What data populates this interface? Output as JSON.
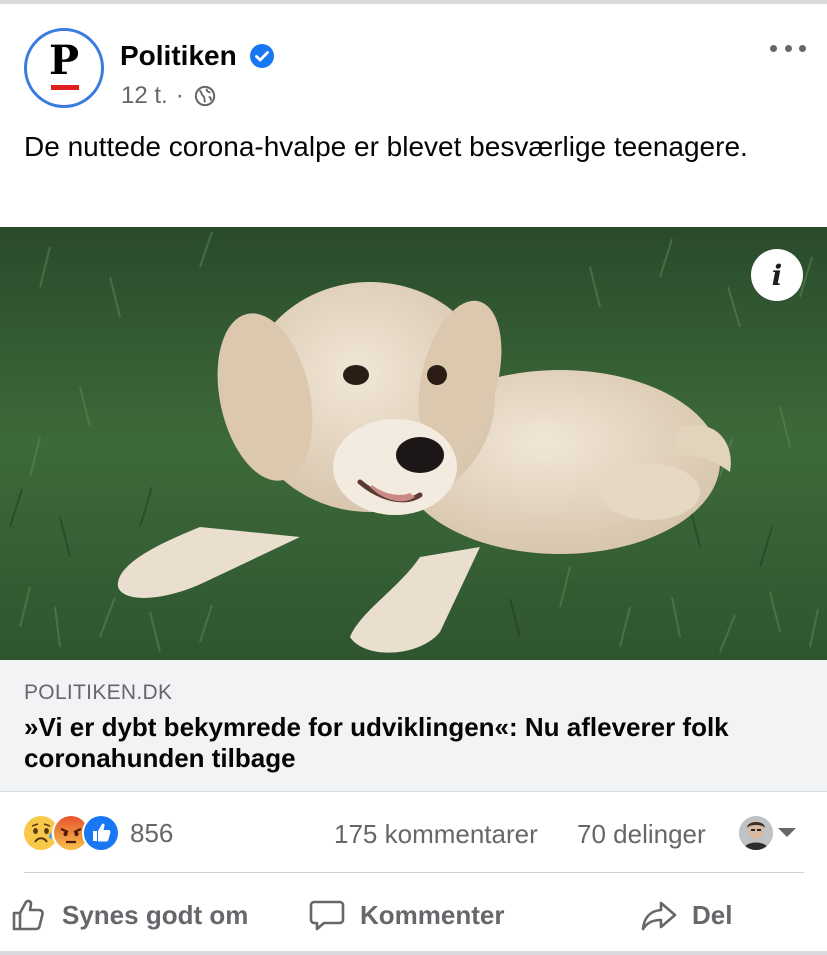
{
  "post": {
    "page_name": "Politiken",
    "avatar_letter": "P",
    "time": "12 t.",
    "separator": "·",
    "audience_icon": "globe-icon",
    "text": "De nuttede corona-hvalpe er blevet besværlige teenagere.",
    "more_icon": "more-horizontal-icon",
    "image_info_label": "i"
  },
  "link": {
    "domain": "POLITIKEN.DK",
    "title": "»Vi er dybt bekymrede for udviklingen«: Nu afleverer folk coronahunden tilbage"
  },
  "engagement": {
    "reaction_icons": [
      "sad-reaction-icon",
      "angry-reaction-icon",
      "like-reaction-icon"
    ],
    "reaction_count": "856",
    "comments": "175 kommentarer",
    "shares": "70 delinger"
  },
  "actions": {
    "like": "Synes godt om",
    "comment": "Kommenter",
    "share": "Del"
  },
  "colors": {
    "brand_blue": "#1877f2",
    "secondary_text": "#65676b",
    "avatar_ring": "#3b7ae0",
    "logo_red": "#e02020"
  }
}
